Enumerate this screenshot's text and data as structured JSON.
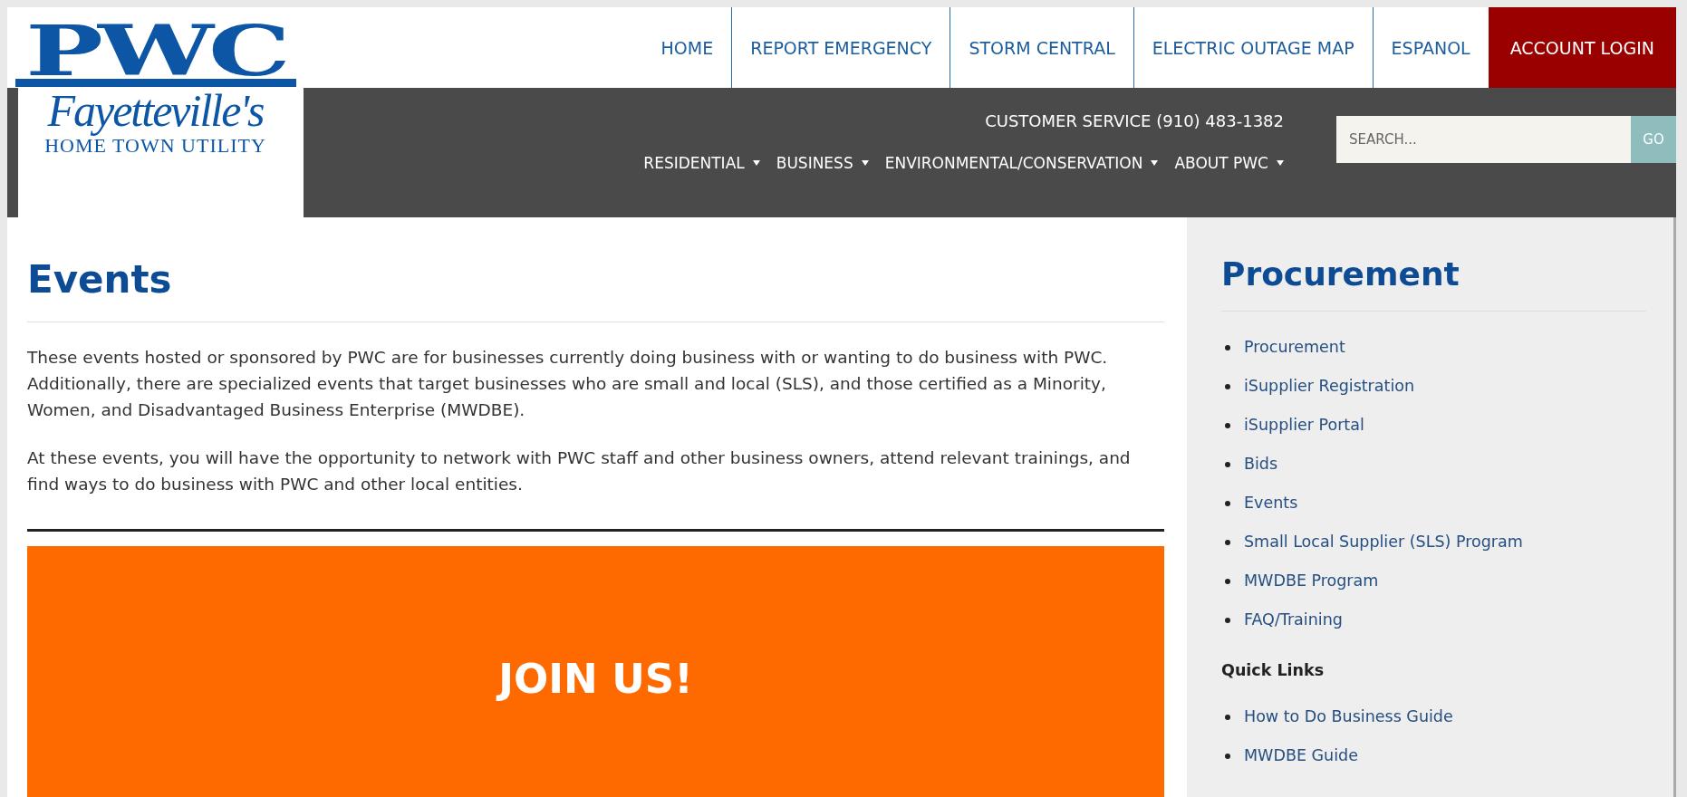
{
  "logo": {
    "mark": "PWC",
    "city": "Fayetteville's",
    "tagline": "HOME TOWN UTILITY"
  },
  "top_nav": [
    {
      "label": "HOME",
      "kind": "link"
    },
    {
      "label": "REPORT EMERGENCY",
      "kind": "link"
    },
    {
      "label": "STORM CENTRAL",
      "kind": "link"
    },
    {
      "label": "ELECTRIC OUTAGE MAP",
      "kind": "link"
    },
    {
      "label": "ESPANOL",
      "kind": "link"
    },
    {
      "label": "ACCOUNT LOGIN",
      "kind": "login"
    }
  ],
  "customer_service": "CUSTOMER SERVICE (910) 483-1382",
  "main_nav": [
    {
      "label": "RESIDENTIAL",
      "has_menu": true
    },
    {
      "label": "BUSINESS",
      "has_menu": true
    },
    {
      "label": "ENVIRONMENTAL/CONSERVATION",
      "has_menu": true
    },
    {
      "label": "ABOUT PWC",
      "has_menu": true
    }
  ],
  "search": {
    "placeholder": "SEARCH...",
    "button": "GO"
  },
  "content": {
    "title": "Events",
    "paragraphs": [
      "These events hosted or sponsored by PWC are for businesses currently doing business with or wanting to do business with PWC. Additionally, there are specialized events that target businesses who are small and local (SLS), and those certified as a Minority, Women, and Disadvantaged Business Enterprise (MWDBE).",
      "At these events, you will have the opportunity to network with PWC staff and other business owners, attend relevant trainings, and find ways to do business with PWC and other local entities."
    ],
    "banner": "JOIN US!"
  },
  "sidebar": {
    "title": "Procurement",
    "links": [
      "Procurement",
      "iSupplier Registration",
      "iSupplier Portal",
      "Bids",
      "Events",
      "Small Local Supplier (SLS) Program",
      "MWDBE Program",
      "FAQ/Training"
    ],
    "quick_links_title": "Quick Links",
    "quick_links": [
      "How to Do Business Guide",
      "MWDBE Guide"
    ]
  }
}
